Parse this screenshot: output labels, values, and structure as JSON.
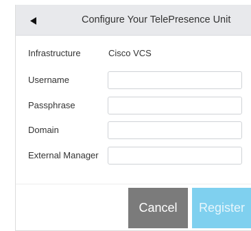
{
  "header": {
    "title": "Configure Your TelePresence Unit"
  },
  "form": {
    "infrastructure": {
      "label": "Infrastructure",
      "value": "Cisco VCS"
    },
    "username": {
      "label": "Username",
      "value": ""
    },
    "passphrase": {
      "label": "Passphrase",
      "value": ""
    },
    "domain": {
      "label": "Domain",
      "value": ""
    },
    "external_manager": {
      "label": "External Manager",
      "value": ""
    }
  },
  "footer": {
    "cancel_label": "Cancel",
    "register_label": "Register"
  },
  "colors": {
    "header_bg": "#e8e9ec",
    "cancel_bg": "#7b7b7b",
    "register_bg": "#7fd0ef"
  },
  "icons": {
    "back": "triangle-left-icon"
  }
}
